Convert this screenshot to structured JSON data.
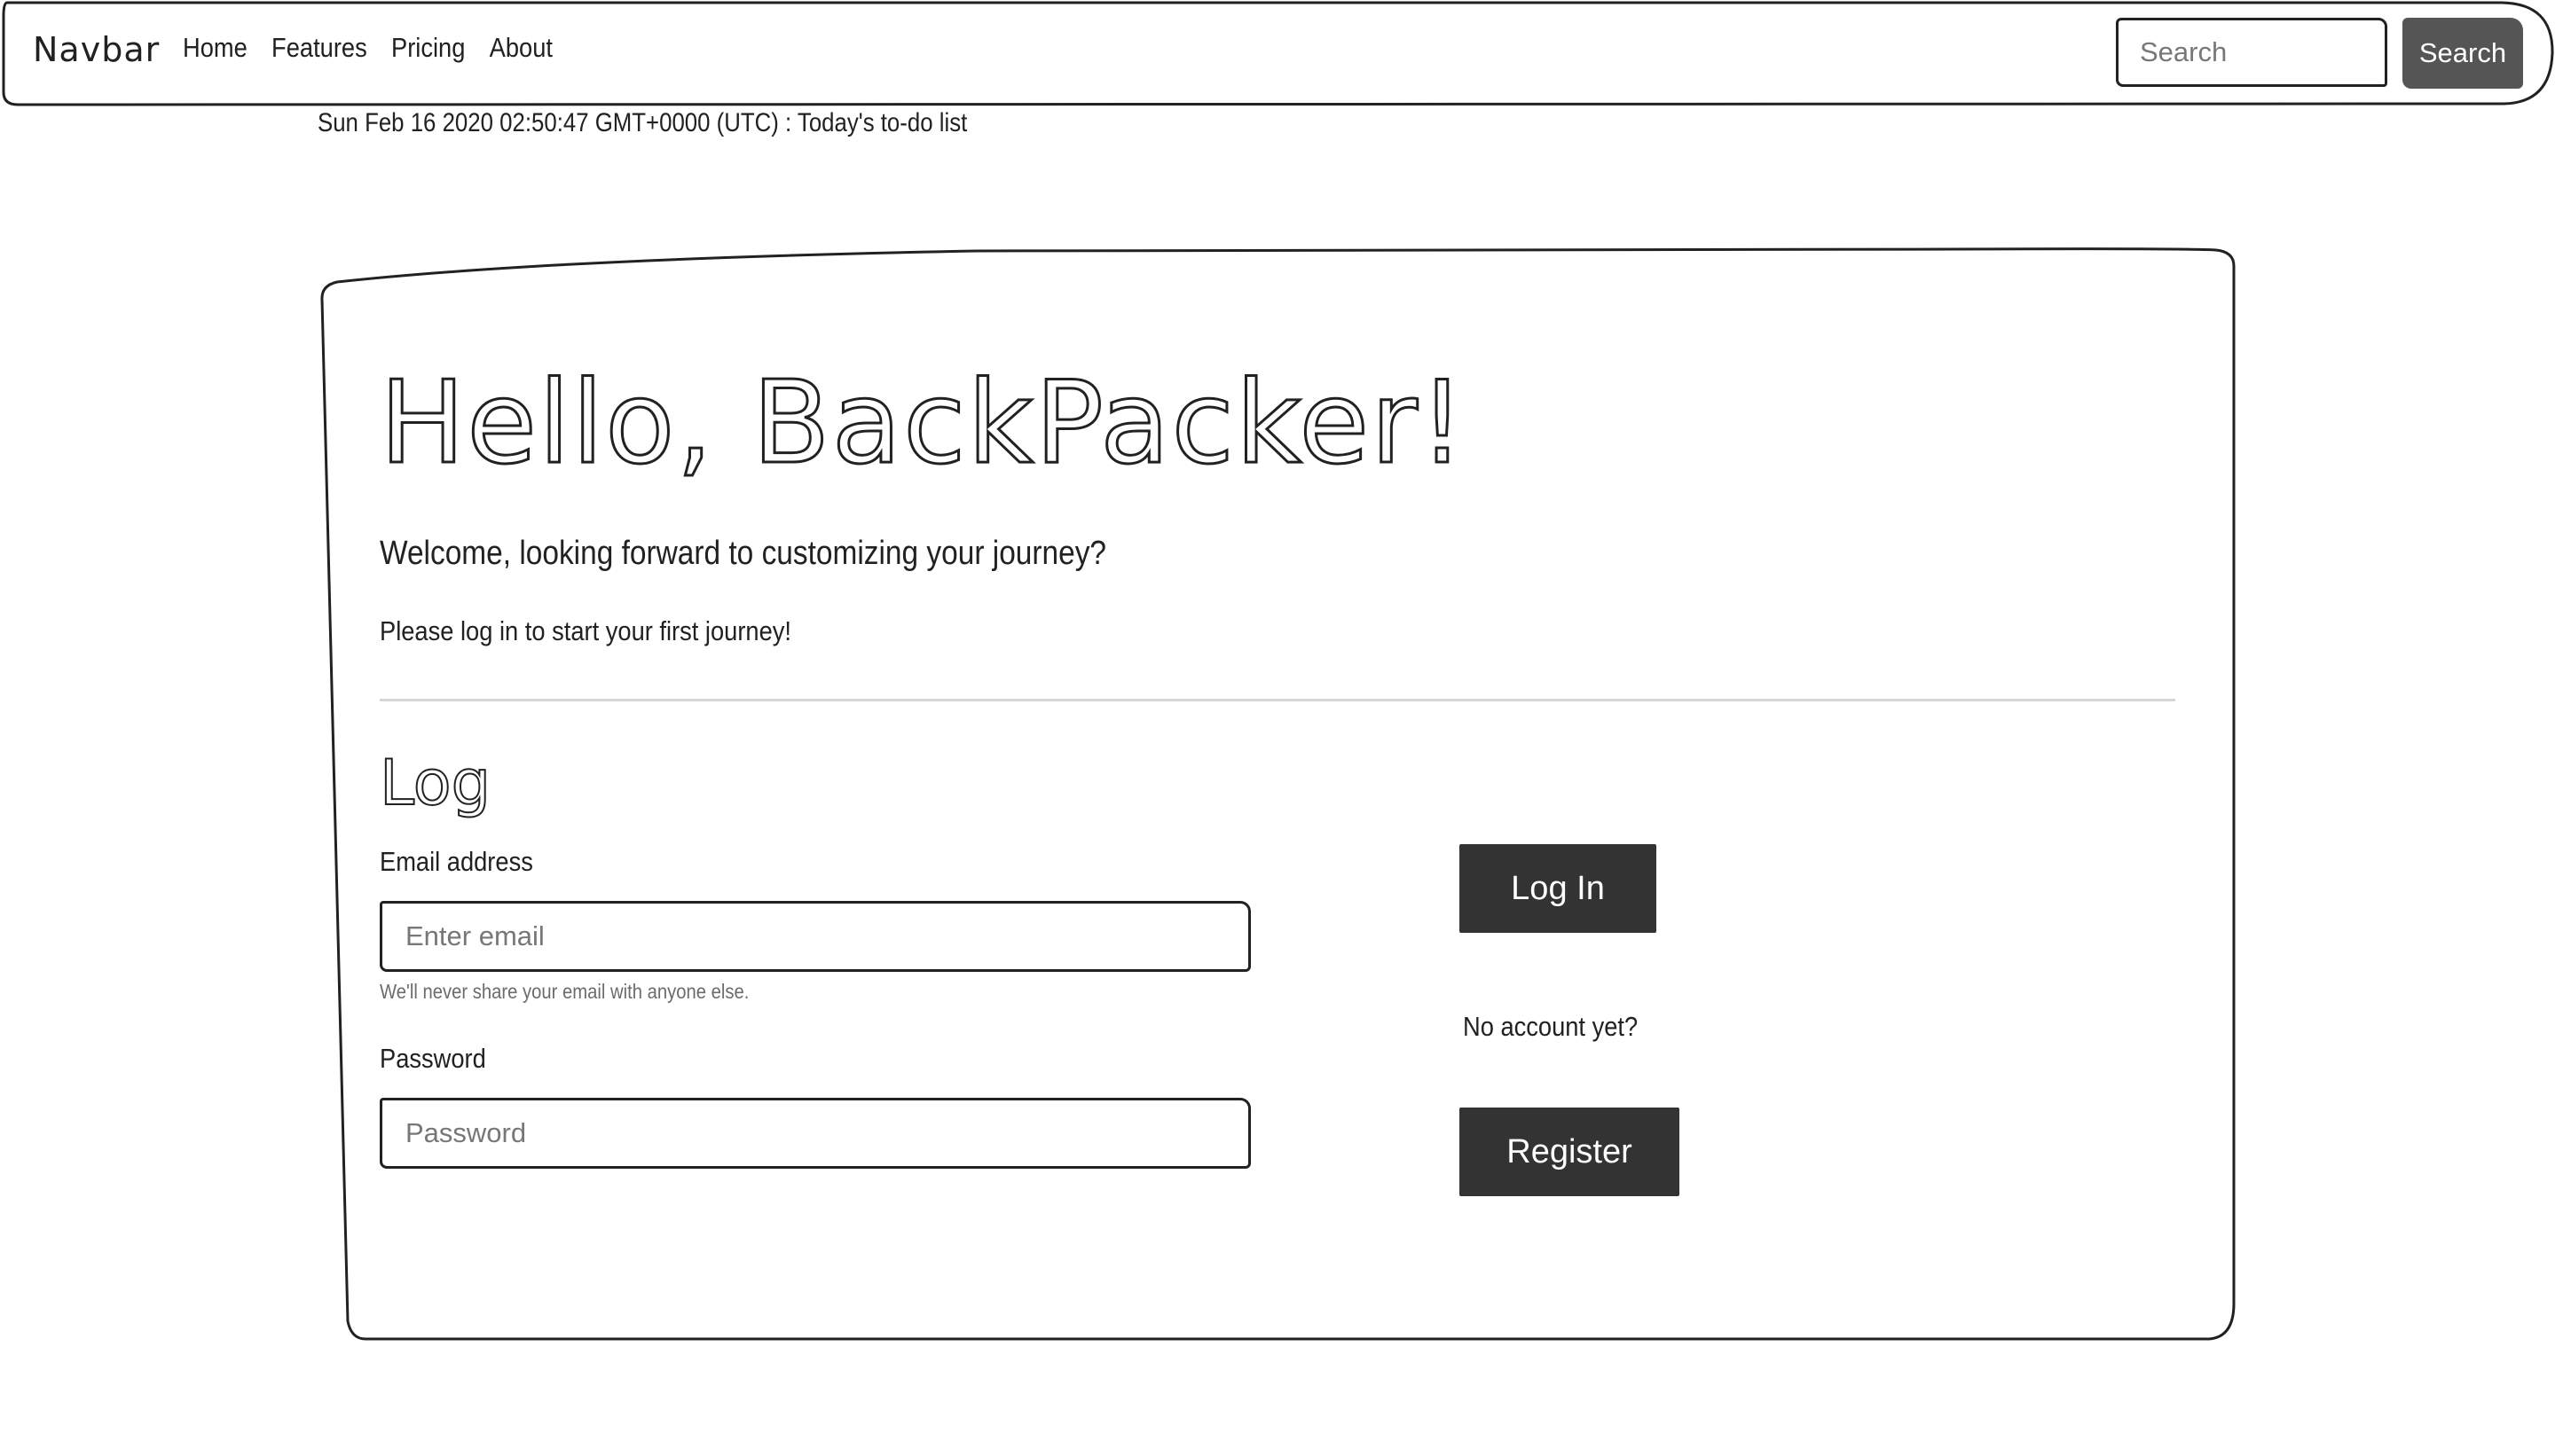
{
  "navbar": {
    "brand": "Navbar",
    "links": [
      "Home",
      "Features",
      "Pricing",
      "About"
    ],
    "search_placeholder": "Search",
    "search_button": "Search"
  },
  "date_line": "Sun Feb 16 2020 02:50:47 GMT+0000 (UTC) : Today's to-do list",
  "jumbotron": {
    "title": "Hello, BackPacker!",
    "lead": "Welcome, looking forward to customizing your journey?",
    "prompt": "Please log in to start your first journey!"
  },
  "login_form": {
    "heading": "Log",
    "email_label": "Email address",
    "email_placeholder": "Enter email",
    "email_help": "We'll never share your email with anyone else.",
    "password_label": "Password",
    "password_placeholder": "Password",
    "login_button": "Log In",
    "no_account_text": "No account yet?",
    "register_button": "Register"
  },
  "colors": {
    "dark_button": "#333333",
    "search_button": "#555555",
    "text": "#212121",
    "muted_text": "#6c6c6c",
    "divider": "#d6d6d6"
  }
}
